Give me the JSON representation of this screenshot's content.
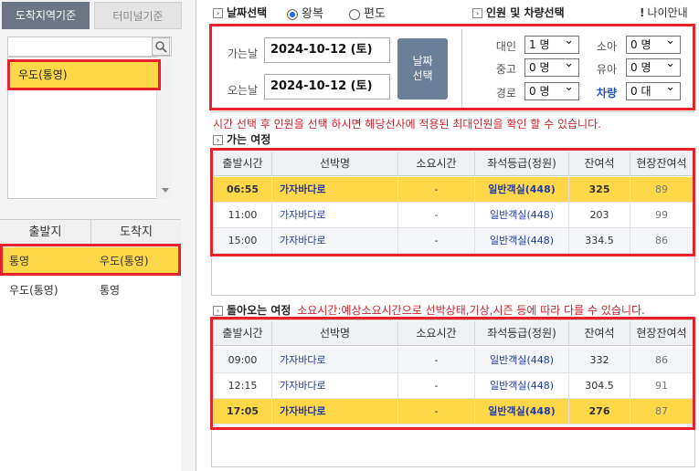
{
  "left": {
    "tabs": [
      "도착지역기준",
      "터미널기준"
    ],
    "region_items": [
      "우도(통영)"
    ],
    "route_headers": [
      "출발지",
      "도착지"
    ],
    "routes": [
      {
        "from": "통영",
        "to": "우도(통영)",
        "selected": true
      },
      {
        "from": "우도(통영)",
        "to": "통영",
        "selected": false
      }
    ]
  },
  "date_section": {
    "title": "날짜선택",
    "radio_round": "왕복",
    "radio_oneway": "편도",
    "go_label": "가는날",
    "go_date": "2024-10-12 (토)",
    "return_label": "오는날",
    "return_date": "2024-10-12 (토)",
    "button_label_1": "날짜",
    "button_label_2": "선택"
  },
  "people_section": {
    "title": "인원 및 차량선택",
    "age_guide": "나이안내",
    "adult_label": "대인",
    "adult_value": "1 명",
    "child_label": "소아",
    "child_value": "0 명",
    "youth_label": "중고",
    "youth_value": "0 명",
    "infant_label": "유아",
    "infant_value": "0 명",
    "senior_label": "경로",
    "senior_value": "0 명",
    "vehicle_label": "차량",
    "vehicle_value": "0 대"
  },
  "notice": "시간 선택 후 인원을 선택 하시면 해당선사에 적용된 최대인원을 확인 할 수 있습니다.",
  "outbound": {
    "title": "가는 여정",
    "headers": [
      "출발시간",
      "선박명",
      "소요시간",
      "좌석등급(정원)",
      "잔여석",
      "현장잔여석"
    ],
    "rows": [
      {
        "time": "06:55",
        "ship": "가자바다로",
        "duration": "-",
        "grade": "일반객실(448)",
        "remaining": "325",
        "onsite": "89",
        "selected": true
      },
      {
        "time": "11:00",
        "ship": "가자바다로",
        "duration": "-",
        "grade": "일반객실(448)",
        "remaining": "203",
        "onsite": "99",
        "selected": false
      },
      {
        "time": "15:00",
        "ship": "가자바다로",
        "duration": "-",
        "grade": "일반객실(448)",
        "remaining": "334.5",
        "onsite": "86",
        "selected": false
      }
    ]
  },
  "inbound": {
    "title": "돌아오는 여정",
    "note": "소요시간:예상소요시간으로 선박상태,기상,시즌 등에 따라 다를 수 있습니다.",
    "headers": [
      "출발시간",
      "선박명",
      "소요시간",
      "좌석등급(정원)",
      "잔여석",
      "현장잔여석"
    ],
    "rows": [
      {
        "time": "09:00",
        "ship": "가자바다로",
        "duration": "-",
        "grade": "일반객실(448)",
        "remaining": "332",
        "onsite": "86",
        "selected": false
      },
      {
        "time": "12:15",
        "ship": "가자바다로",
        "duration": "-",
        "grade": "일반객실(448)",
        "remaining": "304.5",
        "onsite": "91",
        "selected": false
      },
      {
        "time": "17:05",
        "ship": "가자바다로",
        "duration": "-",
        "grade": "일반객실(448)",
        "remaining": "276",
        "onsite": "87",
        "selected": true
      }
    ]
  },
  "colors": {
    "highlight": "#ffd84a",
    "red_box": "#e8222a",
    "link_blue": "#1f3aa8",
    "notice_red": "#c8232c"
  }
}
